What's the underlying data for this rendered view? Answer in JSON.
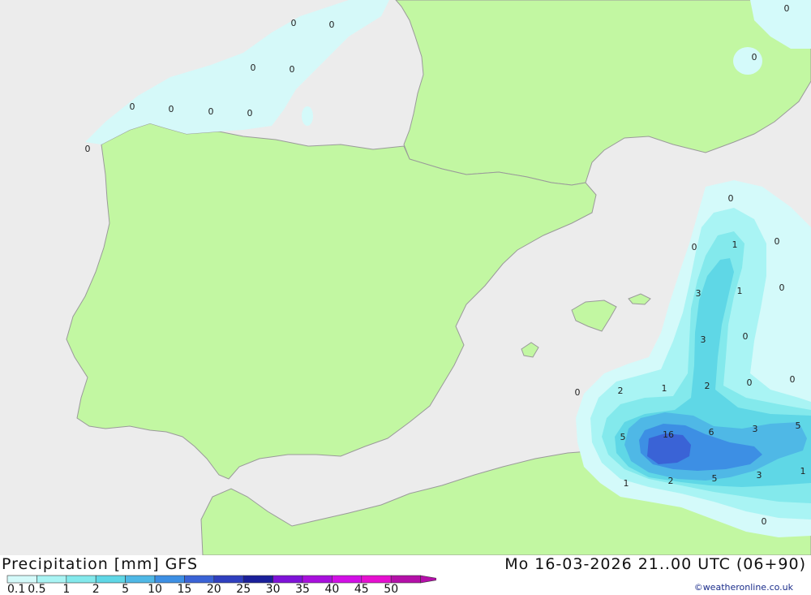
{
  "header": {
    "title": "Precipitation [mm] GFS",
    "datetime": "Mo 16-03-2026 21..00 UTC (06+90)"
  },
  "legend": {
    "stops": [
      {
        "label": "0.1",
        "color": "#d4fafa"
      },
      {
        "label": "0.5",
        "color": "#a9f4f4"
      },
      {
        "label": "1",
        "color": "#83e9ec"
      },
      {
        "label": "2",
        "color": "#5fd7e6"
      },
      {
        "label": "5",
        "color": "#4fb8e6"
      },
      {
        "label": "10",
        "color": "#3d8fe4"
      },
      {
        "label": "15",
        "color": "#3a63d6"
      },
      {
        "label": "20",
        "color": "#2f3fbf"
      },
      {
        "label": "25",
        "color": "#1a1f9a"
      },
      {
        "label": "30",
        "color": "#7e12d8"
      },
      {
        "label": "35",
        "color": "#a80fdd"
      },
      {
        "label": "40",
        "color": "#d20fe6"
      },
      {
        "label": "45",
        "color": "#e60fd0"
      },
      {
        "label": "50",
        "color": "#b40fa8"
      }
    ]
  },
  "map": {
    "land_color": "#c2f7a2",
    "sea_color": "#ececec",
    "border_color": "#9a9a9a",
    "value_labels": [
      "0",
      "0",
      "0",
      "0",
      "0",
      "0",
      "0",
      "0",
      "0",
      "0",
      "0",
      "0",
      "0",
      "0",
      "1",
      "0",
      "0",
      "1",
      "0",
      "3",
      "3",
      "0",
      "0",
      "0",
      "2",
      "1",
      "2",
      "0",
      "5",
      "16",
      "6",
      "3",
      "5",
      "1",
      "2",
      "5",
      "3",
      "1",
      "0"
    ]
  },
  "credit": "©weatheronline.co.uk"
}
